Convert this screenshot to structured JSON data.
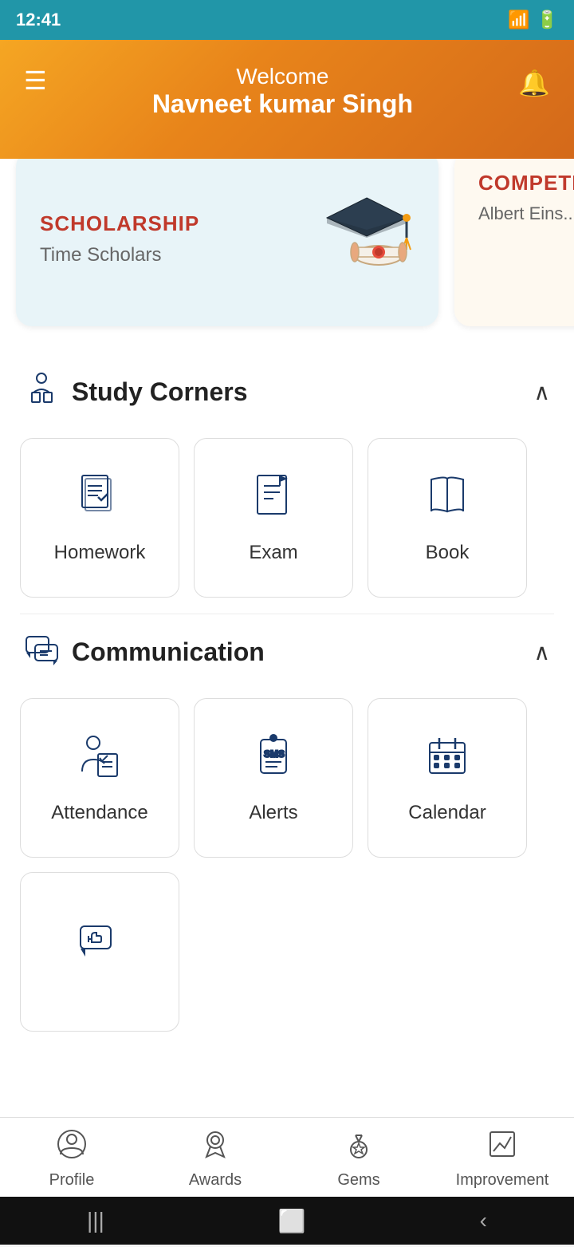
{
  "statusBar": {
    "time": "12:41",
    "icons": [
      "image",
      "alert",
      "sim"
    ]
  },
  "header": {
    "welcome": "Welcome",
    "name": "Navneet kumar Singh"
  },
  "cards": [
    {
      "type": "SCHOLARSHIP",
      "name": "Time Scholars",
      "image": "🎓"
    },
    {
      "type": "COMPETI...",
      "name": "Albert Eins... Scholarshi..."
    }
  ],
  "studyCorners": {
    "title": "Study Corners",
    "items": [
      {
        "label": "Homework",
        "icon": "homework"
      },
      {
        "label": "Exam",
        "icon": "exam"
      },
      {
        "label": "Book",
        "icon": "book"
      }
    ]
  },
  "communication": {
    "title": "Communication",
    "items": [
      {
        "label": "Attendance",
        "icon": "attendance"
      },
      {
        "label": "Alerts",
        "icon": "alerts"
      },
      {
        "label": "Calendar",
        "icon": "calendar"
      },
      {
        "label": "Feedback",
        "icon": "feedback"
      }
    ]
  },
  "bottomNav": [
    {
      "label": "Profile",
      "icon": "profile"
    },
    {
      "label": "Awards",
      "icon": "awards"
    },
    {
      "label": "Gems",
      "icon": "gems"
    },
    {
      "label": "Improvement",
      "icon": "improvement"
    }
  ]
}
